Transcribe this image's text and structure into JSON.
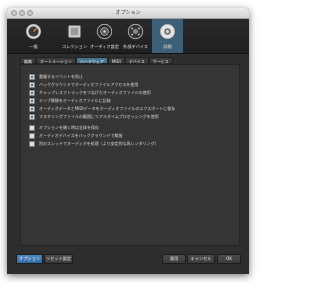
{
  "window": {
    "title": "オプション"
  },
  "toolbar": {
    "items": [
      {
        "label": "一般",
        "icon": "gauge-icon"
      },
      {
        "label": "コレクション",
        "icon": "collection-icon"
      },
      {
        "label": "オーディオ設定",
        "icon": "speaker-icon"
      },
      {
        "label": "外部デバイス",
        "icon": "device-icon"
      },
      {
        "label": "詳細",
        "icon": "advanced-gear-icon"
      }
    ],
    "active_index": 4
  },
  "tabs": {
    "items": [
      "編集",
      "オートメーション",
      "ハードウェア",
      "MIDI",
      "デバイス",
      "サービス"
    ],
    "active_index": 2
  },
  "options": [
    {
      "label": "重複するイベントを防止",
      "checked": true
    },
    {
      "label": "バックグラウンドでオーディオファイルアクセスを使用",
      "checked": true
    },
    {
      "label": "ギャップレスでトラックをつなげたオーディオファイルの使用",
      "checked": true
    },
    {
      "label": "テンプ情報をオーディオファイルに記録",
      "checked": true
    },
    {
      "label": "オーディオデータとMIDIデータをオーディオファイルのエクスポートに保存",
      "checked": true
    },
    {
      "label": "マスタリングファイルの範囲にリアルタイムプロセッシングを使用",
      "checked": true
    },
    {
      "label": "オプションを開く時は全体を保存",
      "checked": false
    },
    {
      "label": "オーディオデバイスをバックグラウンドで解放",
      "checked": false
    },
    {
      "label": "別のスレッドでオーディオを処理（より安定的な再レンダリング）",
      "checked": false
    }
  ],
  "footer": {
    "left_button": "オプション",
    "left_button2": "リセット設定",
    "apply": "適用",
    "cancel": "キャンセル",
    "ok": "OK"
  },
  "colors": {
    "accent": "#3d5f78",
    "tab_active": "#47748f",
    "primary_button": "#3a76b3"
  }
}
